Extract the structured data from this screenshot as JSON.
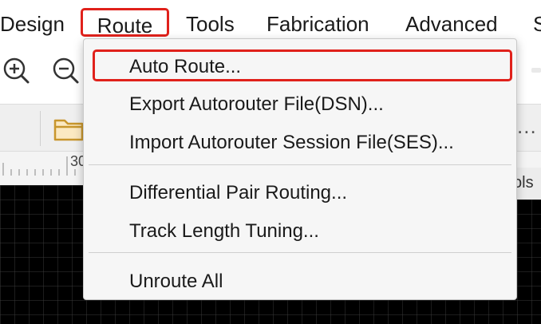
{
  "menubar": {
    "items": [
      "Design",
      "Route",
      "Tools",
      "Fabrication",
      "Advanced",
      "S"
    ]
  },
  "toolbar": {
    "icons": [
      "zoom-in-icon",
      "zoom-out-icon"
    ]
  },
  "subbar": {
    "folder_icon": "folder-icon",
    "dots": "..."
  },
  "ruler": {
    "number": "30"
  },
  "panel": {
    "tab_label": "ols"
  },
  "route_menu": {
    "items": [
      "Auto Route...",
      "Export Autorouter File(DSN)...",
      "Import Autorouter Session File(SES)...",
      "Differential Pair Routing...",
      "Track Length Tuning...",
      "Unroute All"
    ]
  },
  "colors": {
    "highlight": "#e0211b",
    "folder": "#c8962d",
    "canvas": "#000000"
  }
}
